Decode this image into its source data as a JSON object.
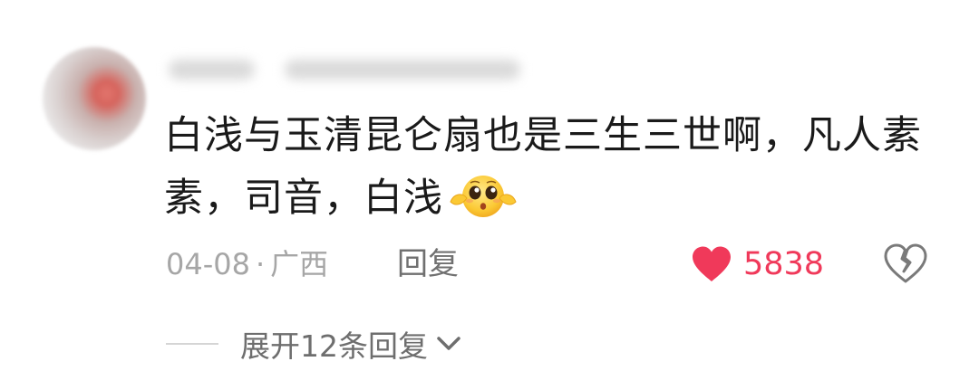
{
  "comment": {
    "text": "白浅与玉清昆仑扇也是三生三世啊，凡人素素，司音，白浅",
    "emoji": "hug-emoji",
    "date": "04-08",
    "separator": "·",
    "location": "广西",
    "reply_label": "回复",
    "like_count": "5838",
    "expand_label": "展开12条回复"
  },
  "icons": {
    "like": "heart-icon",
    "dislike": "broken-heart-icon",
    "expand": "chevron-down-icon"
  },
  "colors": {
    "like_accent": "#f0395a",
    "meta_text": "#a6a6a6",
    "body_text": "#1a1a1a"
  }
}
